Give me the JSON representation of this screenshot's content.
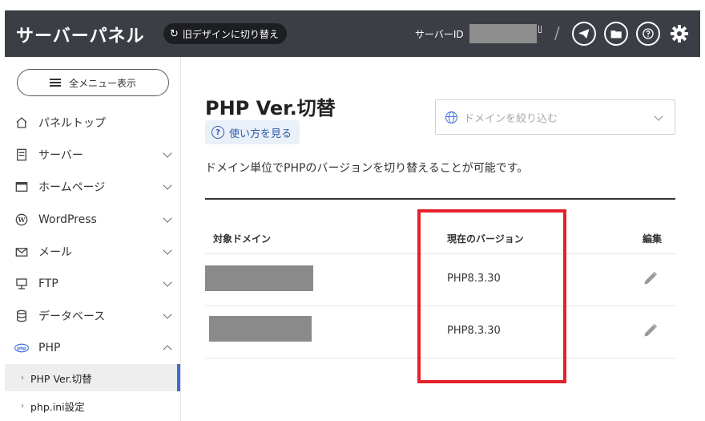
{
  "header": {
    "title": "サーバーパネル",
    "old_design_label": "旧デザインに切り替え",
    "server_id_label": "サーバーID",
    "separator": "/",
    "icons": [
      "telegram-icon",
      "folder-icon",
      "help-icon",
      "gear-icon"
    ]
  },
  "sidebar": {
    "menu_button": "全メニュー表示",
    "items": [
      {
        "label": "パネルトップ",
        "icon": "home-icon"
      },
      {
        "label": "サーバー",
        "icon": "server-icon"
      },
      {
        "label": "ホームページ",
        "icon": "browser-icon"
      },
      {
        "label": "WordPress",
        "icon": "wordpress-icon"
      },
      {
        "label": "メール",
        "icon": "mail-icon"
      },
      {
        "label": "FTP",
        "icon": "ftp-icon"
      },
      {
        "label": "データベース",
        "icon": "database-icon"
      },
      {
        "label": "PHP",
        "icon": "php-icon"
      }
    ],
    "sub_items": [
      {
        "label": "PHP Ver.切替",
        "active": true
      },
      {
        "label": "php.ini設定",
        "active": false
      }
    ]
  },
  "main": {
    "title": "PHP Ver.切替",
    "help_link": "使い方を見る",
    "domain_filter_placeholder": "ドメインを絞り込む",
    "description": "ドメイン単位でPHPのバージョンを切り替えることが可能です。",
    "table": {
      "columns": [
        "対象ドメイン",
        "現在のバージョン",
        "編集"
      ],
      "rows": [
        {
          "version": "PHP8.3.30"
        },
        {
          "version": "PHP8.3.30"
        }
      ]
    }
  },
  "colors": {
    "header_bg": "#3b3f45",
    "accent_blue": "#3d6dd8",
    "highlight_red": "#e5212b"
  }
}
